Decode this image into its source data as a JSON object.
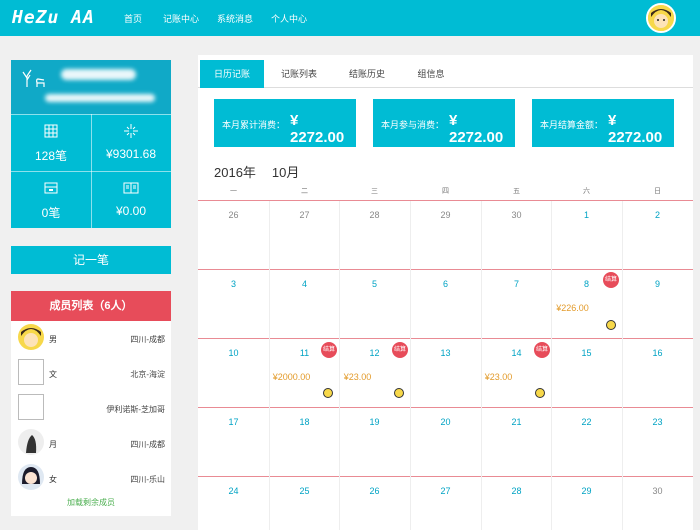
{
  "topbar": {
    "logo": "HeZu AA",
    "nav": [
      "首页",
      "记账中心",
      "系统消息",
      "个人中心"
    ]
  },
  "profile": {
    "stats": [
      {
        "icon": "grid-icon",
        "value": "128笔"
      },
      {
        "icon": "sparkle-icon",
        "value": "¥9301.68"
      },
      {
        "icon": "inbox-icon",
        "value": "0笔"
      },
      {
        "icon": "book-icon",
        "value": "¥0.00"
      }
    ]
  },
  "record_button": "记一笔",
  "members": {
    "title": "成员列表（6人）",
    "items": [
      {
        "name": "男",
        "addr": "四川-成都"
      },
      {
        "name": "文",
        "addr": "北京-海淀"
      },
      {
        "name": "",
        "addr": "伊利诺斯-芝加哥"
      },
      {
        "name": "月",
        "addr": "四川-成都"
      },
      {
        "name": "女",
        "addr": "四川-乐山"
      }
    ],
    "load_more": "加载剩余成员"
  },
  "tabs": [
    "日历记账",
    "记账列表",
    "结账历史",
    "组信息"
  ],
  "summary": [
    {
      "label": "本月累计消费：",
      "amount": "¥ 2272.00"
    },
    {
      "label": "本月参与消费：",
      "amount": "¥ 2272.00"
    },
    {
      "label": "本月结算金额：",
      "amount": "¥ 2272.00"
    }
  ],
  "calendar": {
    "year": "2016年",
    "month": "10月",
    "weekdays": [
      "一",
      "二",
      "三",
      "四",
      "五",
      "六",
      "日"
    ],
    "weeks": [
      [
        "26",
        "27",
        "28",
        "29",
        "30",
        "1",
        "2"
      ],
      [
        "3",
        "4",
        "5",
        "6",
        "7",
        "8",
        "9"
      ],
      [
        "10",
        "11",
        "12",
        "13",
        "14",
        "15",
        "16"
      ],
      [
        "17",
        "18",
        "19",
        "20",
        "21",
        "22",
        "23"
      ],
      [
        "24",
        "25",
        "26",
        "27",
        "28",
        "29",
        "30"
      ]
    ],
    "settle_label": "结算",
    "amounts": {
      "d8": "¥226.00",
      "d11": "¥2000.00",
      "d12": "¥23.00",
      "d14": "¥23.00"
    }
  },
  "colors": {
    "accent": "#00bcd4",
    "danger": "#e74c5a",
    "amount": "#e39b2b"
  }
}
